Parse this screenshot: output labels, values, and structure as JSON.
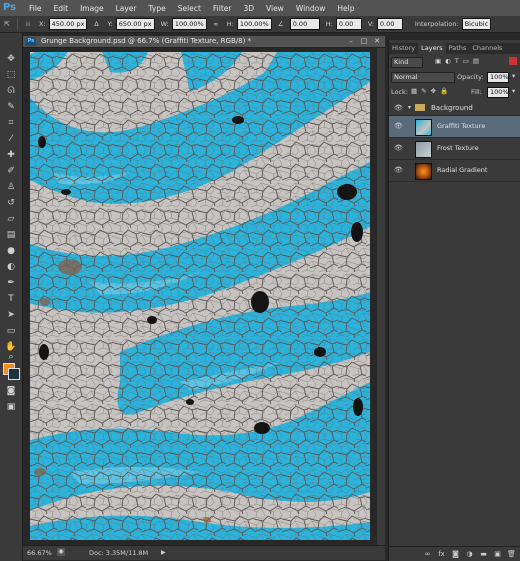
{
  "app": {
    "logo": "Ps"
  },
  "menu": [
    "File",
    "Edit",
    "Image",
    "Layer",
    "Type",
    "Select",
    "Filter",
    "3D",
    "View",
    "Window",
    "Help"
  ],
  "options": {
    "x_label": "X:",
    "x_value": "450.00 px",
    "y_label": "Y:",
    "y_value": "650.00 px",
    "w_label": "W:",
    "w_value": "100.00%",
    "h_label": "H:",
    "h_value": "100.00%",
    "angle_value": "0.00",
    "hskew_label": "H:",
    "hskew_value": "0.00",
    "vskew_label": "V:",
    "vskew_value": "0.00",
    "interp_label": "Interpolation:",
    "interp_value": "Bicubic"
  },
  "document": {
    "title": "Grunge Background.psd @ 66.7% (Graffiti Texture, RGB/8) *",
    "zoom": "66.67%",
    "doc_size": "Doc: 3.35M/11.8M"
  },
  "colors": {
    "foreground": "#f28a24",
    "background": "#1b3440",
    "paint": "#2cb3dc",
    "wall": "#c7c3c0"
  },
  "panel": {
    "tabs": [
      "History",
      "Layers",
      "Paths",
      "Channels"
    ],
    "active_tab": "Layers",
    "filter_kind": "Kind",
    "blend_mode": "Normal",
    "opacity_label": "Opacity:",
    "opacity_value": "100%",
    "lock_label": "Lock:",
    "fill_label": "Fill:",
    "fill_value": "100%",
    "group_name": "Background",
    "layers": [
      {
        "name": "Graffiti Texture",
        "selected": true
      },
      {
        "name": "Frost Texture",
        "selected": false
      },
      {
        "name": "Radial Gradient",
        "selected": false
      }
    ]
  },
  "icons": [
    "move-tool-icon",
    "marquee-icon",
    "lasso-icon",
    "quick-select-icon",
    "crop-icon",
    "eyedropper-icon",
    "healing-icon",
    "brush-icon",
    "stamp-icon",
    "history-brush-icon",
    "eraser-icon",
    "gradient-icon",
    "blur-icon",
    "dodge-icon",
    "pen-icon",
    "type-icon",
    "path-select-icon",
    "shape-icon",
    "hand-icon",
    "zoom-icon",
    "eye-icon",
    "folder-icon",
    "link-icon",
    "fx-icon",
    "mask-icon",
    "adjustment-icon",
    "group-icon",
    "new-layer-icon",
    "trash-icon"
  ]
}
